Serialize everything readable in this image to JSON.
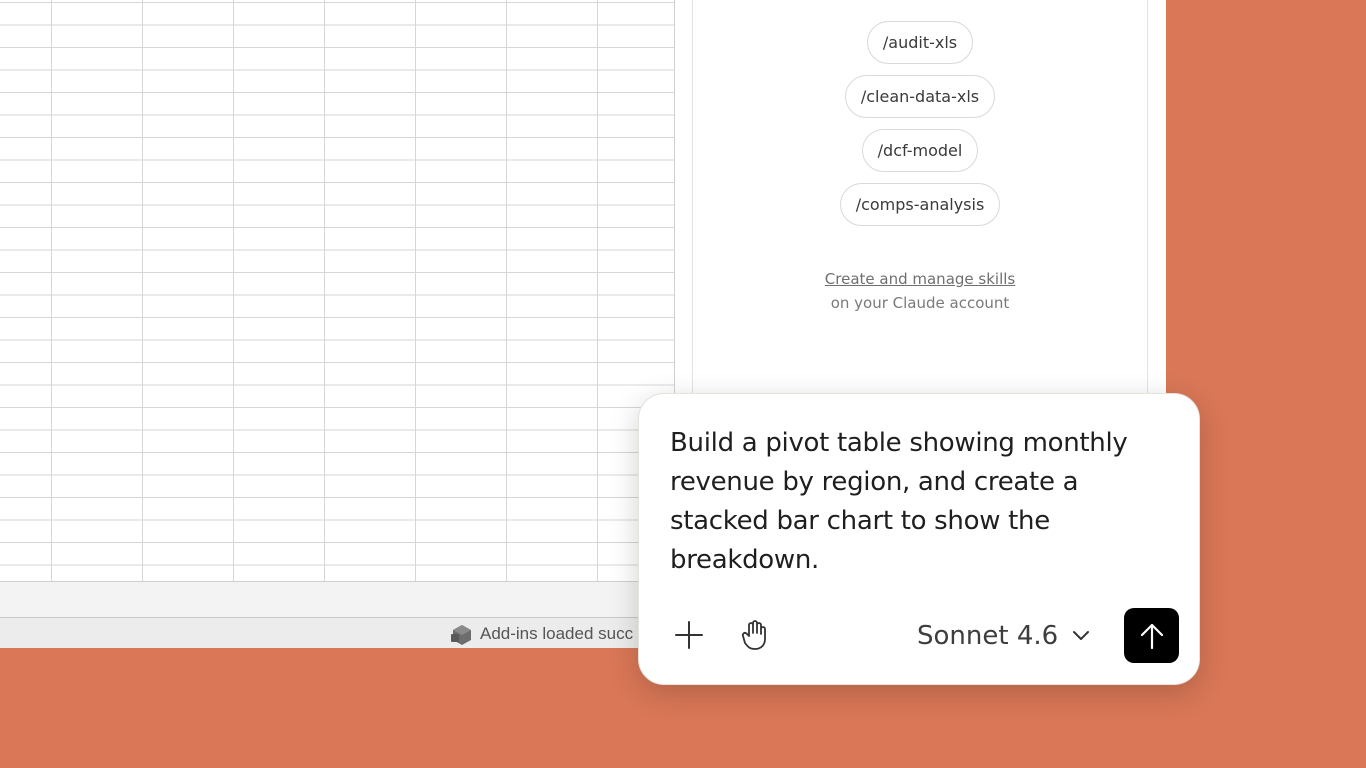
{
  "status_bar": {
    "message": "Add-ins loaded succ"
  },
  "skills_panel": {
    "chips": [
      {
        "label": "/audit-xls"
      },
      {
        "label": "/clean-data-xls"
      },
      {
        "label": "/dcf-model"
      },
      {
        "label": "/comps-analysis"
      }
    ],
    "manage_link": "Create and manage skills",
    "manage_sub": "on your Claude account"
  },
  "composer": {
    "prompt": "Build a pivot table showing monthly revenue by region, and create a stacked bar chart to show the breakdown.",
    "model": "Sonnet 4.6",
    "icons": {
      "add": "plus-icon",
      "hand": "hand-icon",
      "model_dropdown": "chevron-down-icon",
      "send": "arrow-up-icon"
    }
  },
  "colors": {
    "background": "#d97757",
    "send_button": "#000000"
  }
}
